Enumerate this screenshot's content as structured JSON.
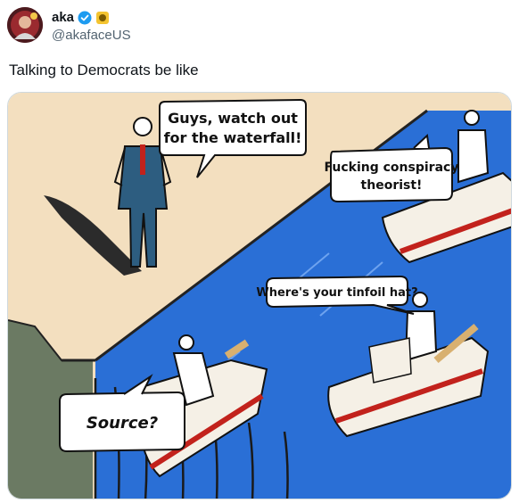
{
  "tweet": {
    "author": {
      "display_name": "aka",
      "handle": "@akafaceUS",
      "verified_icon": "verified-check-icon",
      "affiliate_icon": "gold-badge-icon"
    },
    "text": "Talking to Democrats be like",
    "media": {
      "bubbles": {
        "man_line1": "Guys, watch out",
        "man_line2": "for the waterfall!",
        "boat1_line1": "Fucking conspiracy",
        "boat1_line2": "theorist!",
        "boat2": "Where's your tinfoil hat?",
        "boat3": "Source?"
      }
    }
  },
  "colors": {
    "river": "#2a6fd6",
    "sand": "#f3dfbf",
    "boat_stripe": "#c2221c",
    "verified": "#1d9bf0",
    "handle": "#536471"
  }
}
